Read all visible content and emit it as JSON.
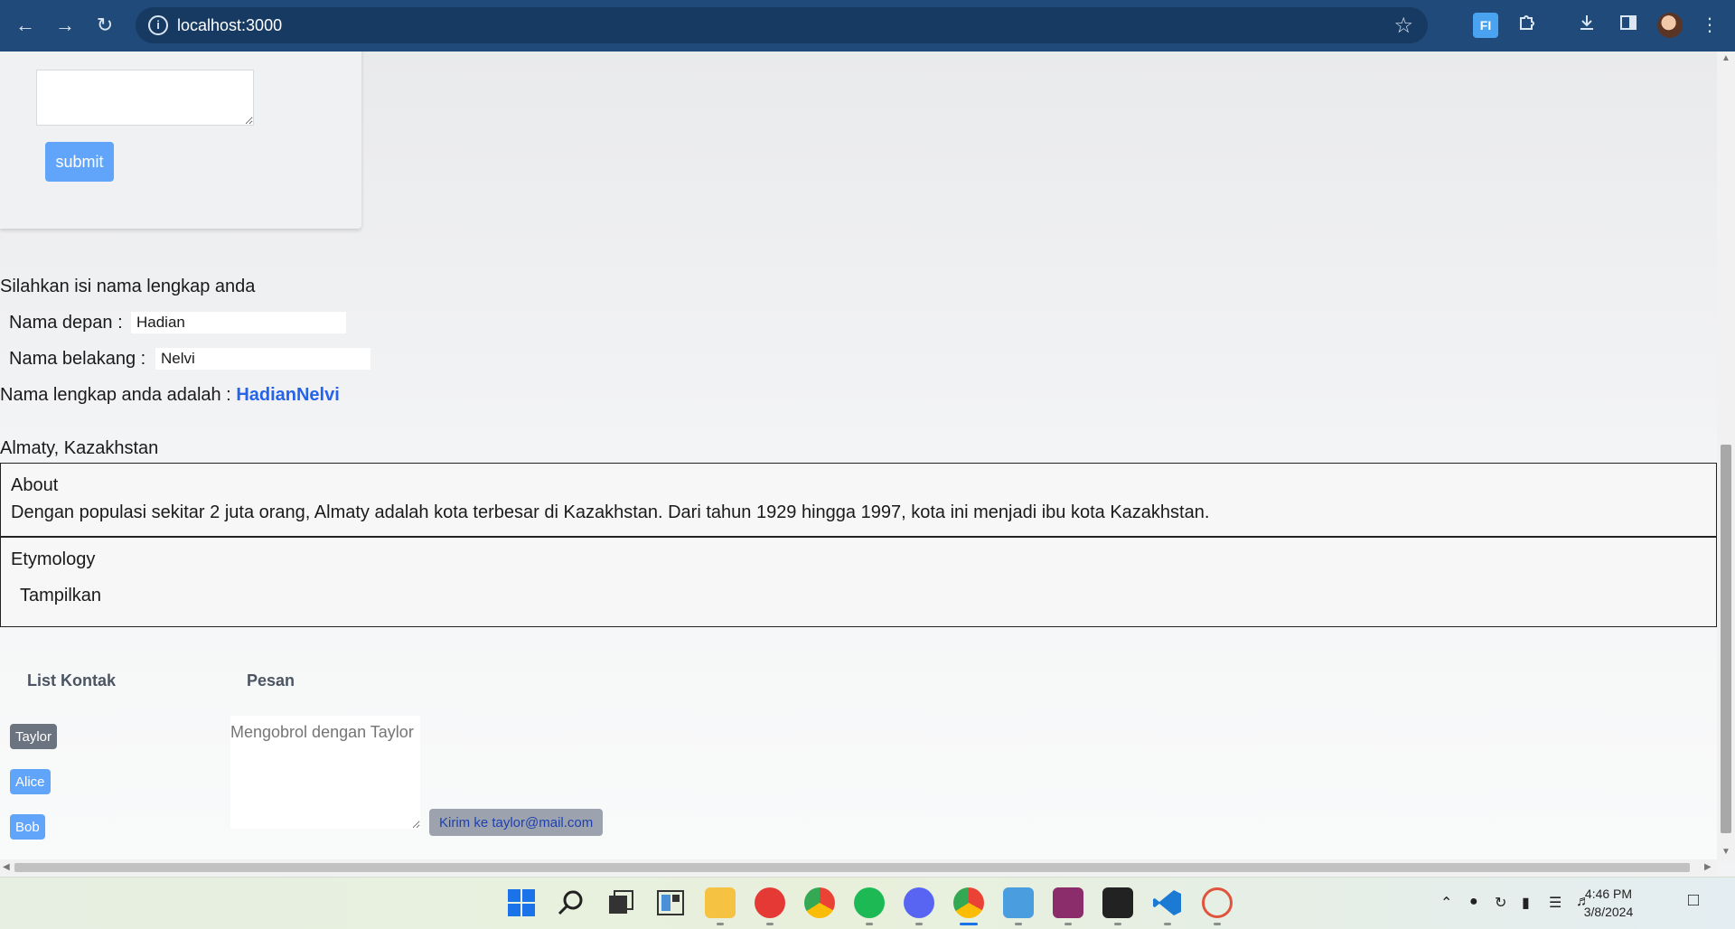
{
  "browser": {
    "url": "localhost:3000",
    "back_icon": "arrow-left-icon",
    "forward_icon": "arrow-right-icon",
    "reload_icon": "reload-icon",
    "site_info_icon": "info-icon",
    "bookmark_icon": "star-icon",
    "extensions": [
      "fi-extension-icon",
      "puzzle-icon"
    ],
    "toolbar_icons": [
      "download-icon",
      "side-panel-icon",
      "profile-avatar",
      "kebab-menu-icon"
    ],
    "fi_label": "FI"
  },
  "form": {
    "submit_label": "submit"
  },
  "name_section": {
    "prompt": "Silahkan isi nama lengkap anda",
    "first_label": "Nama depan :",
    "first_value": "Hadian",
    "last_label": "Nama belakang :",
    "last_value": "Nelvi",
    "result_label": "Nama lengkap anda adalah :",
    "result_value": "HadianNelvi"
  },
  "city": {
    "name": "Almaty, Kazakhstan",
    "about_title": "About",
    "about_text": "Dengan populasi sekitar 2 juta orang, Almaty adalah kota terbesar di Kazakhstan. Dari tahun 1929 hingga 1997, kota ini menjadi ibu kota Kazakhstan.",
    "etymology_title": "Etymology",
    "show_label": "Tampilkan"
  },
  "chat": {
    "contacts_header": "List Kontak",
    "message_header": "Pesan",
    "contacts": [
      {
        "name": "Taylor",
        "active": true
      },
      {
        "name": "Alice",
        "active": false
      },
      {
        "name": "Bob",
        "active": false
      }
    ],
    "placeholder": "Mengobrol dengan Taylor",
    "send_label": "Kirim ke taylor@mail.com"
  },
  "taskbar": {
    "apps": [
      "windows-start-icon",
      "search-icon",
      "task-view-icon",
      "widgets-icon",
      "file-explorer-icon",
      "wps-office-icon",
      "chrome-icon",
      "spotify-icon",
      "discord-icon",
      "chrome-profile-icon",
      "notepad-icon",
      "winrar-icon",
      "terminal-icon",
      "vscode-icon",
      "snipping-tool-icon"
    ],
    "time": "4:46 PM",
    "date": "3/8/2024"
  },
  "colors": {
    "chrome_bar": "#1f4a7a",
    "accent_blue": "#60a5fa",
    "link_blue": "#2563eb",
    "active_contact": "#6b7280"
  }
}
